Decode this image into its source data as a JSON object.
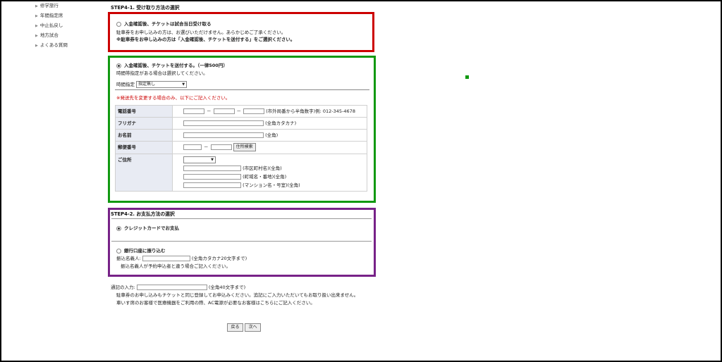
{
  "sidebar": {
    "items": [
      {
        "label": "修学旅行"
      },
      {
        "label": "年間指定席"
      },
      {
        "label": "中止払戻し"
      },
      {
        "label": "地方試合"
      },
      {
        "label": "よくある質問"
      }
    ]
  },
  "step1": {
    "title": "STEP4-1. 受け取り方法の選択",
    "option_venue": {
      "label": "入金確認後、チケットは試合当日受け取る",
      "note1": "駐車券をお申し込みの方は、お選びいただけません。あらかじめご了承ください。",
      "note2": "※駐車券をお申し込みの方は「入金確認後、チケットを送付する」をご選択ください。"
    },
    "option_ship": {
      "label": "入金確認後、チケットを送付する。（一律500円）",
      "note": "時間帯指定がある場合は選択してください。",
      "time_label": "時間指定",
      "time_value": "指定無し",
      "change_note": "※発送先を変更する場合のみ、以下にご記入ください。"
    },
    "form": {
      "phone_label": "電話番号",
      "phone_note": "(市外局番から半角数字)例: 012-345-4678",
      "furigana_label": "フリガナ",
      "furigana_note": "(全角カタカナ)",
      "name_label": "お名前",
      "name_note": "(全角)",
      "postal_label": "郵便番号",
      "postal_button": "住所検索",
      "address_label": "ご住所",
      "address_note1": "(市区町村名)(全角)",
      "address_note2": "(町域名・番地)(全角)",
      "address_note3": "(マンション名・号室)(全角)"
    }
  },
  "step2": {
    "title": "STEP4-2. お支払方法の選択",
    "credit_label": "クレジットカードでお支払",
    "bank_label": "銀行口座に振り込む",
    "payer_label": "振込名義人:",
    "payer_note": "(全角カタカナ20文字まで)",
    "payer_sub": "振込名義人が予約申込者と違う場合ご記入ください。"
  },
  "remarks": {
    "label": "通記の入力:",
    "limit": "(全角40文字まで)",
    "note1": "駐車券のお申し込みもチケットと同じ登録してお申込みください。追記にご入力いただいてもお取り扱い出来ません。",
    "note2": "車いす席のお客様で医療機器をご利用の際、AC電源が必要なお客様はこちらにご記入ください。"
  },
  "nav": {
    "back": "戻る",
    "next": "次へ"
  }
}
